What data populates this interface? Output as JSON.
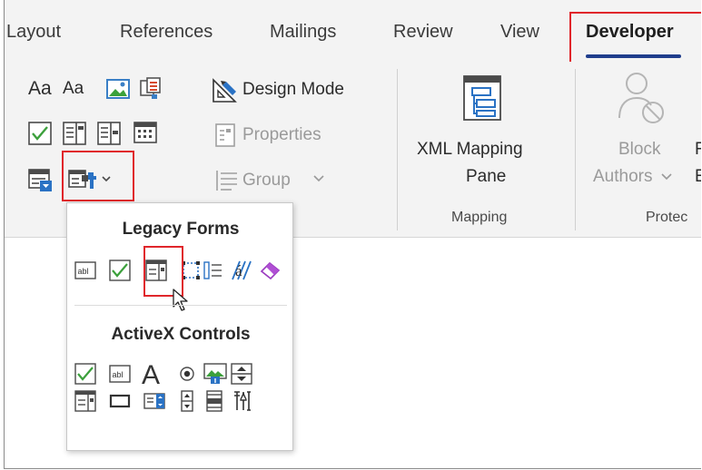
{
  "tabs": [
    {
      "label": "Layout"
    },
    {
      "label": "References"
    },
    {
      "label": "Mailings"
    },
    {
      "label": "Review"
    },
    {
      "label": "View"
    },
    {
      "label": "Developer",
      "active": true
    }
  ],
  "controls_group": {
    "text_labels": [
      "Aa",
      "Aa"
    ],
    "design_mode_label": "Design Mode",
    "properties_label": "Properties",
    "group_label": "Group"
  },
  "mapping_group": {
    "xml_mapping_line1": "XML Mapping",
    "xml_mapping_line2": "Pane",
    "label": "Mapping"
  },
  "protect_group": {
    "block_line1": "Block",
    "block_line2": "Authors",
    "partial_line1": "F",
    "partial_line2": "E",
    "label": "Protec"
  },
  "dropdown": {
    "legacy_heading": "Legacy Forms",
    "activex_heading": "ActiveX Controls",
    "legacy_items": [
      "text-form-field-icon",
      "check-box-form-field-icon",
      "drop-down-form-field-icon",
      "insert-frame-icon",
      "form-field-shading-icon",
      "reset-form-fields-icon"
    ],
    "activex_items": [
      "checkbox-icon",
      "textbox-icon",
      "label-icon",
      "option-button-icon",
      "image-icon",
      "spin-button-icon",
      "list-box-icon",
      "command-button-icon",
      "combo-box-icon",
      "toggle-button-icon",
      "scroll-bar-icon",
      "more-controls-icon"
    ]
  },
  "colors": {
    "accent_underline": "#1f3d8c",
    "highlight_box": "#e0262b",
    "check_green": "#3ca03c",
    "ribbon_bg": "#f3f3f3"
  }
}
